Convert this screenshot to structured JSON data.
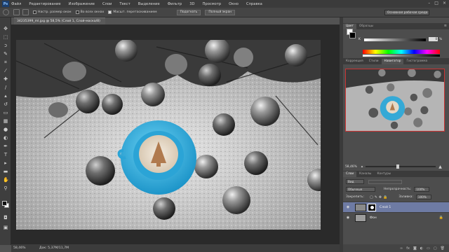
{
  "app": {
    "logo": "Ps",
    "menu": [
      "Файл",
      "Редактирование",
      "Изображение",
      "Слои",
      "Текст",
      "Выделение",
      "Фильтр",
      "3D",
      "Просмотр",
      "Окно",
      "Справка"
    ],
    "window_buttons": [
      "–",
      "□",
      "×"
    ]
  },
  "options": {
    "resize_label": "Настр. размер окон",
    "all_windows_label": "Во всех окнах",
    "scrubby_label": "Масшт. перетаскиванием",
    "fit_button": "Подогнать",
    "fullscreen_button": "Полный экран",
    "workspace": "Основная рабочая среда"
  },
  "document": {
    "tab_title": "34235399_ml.jpg @ 58,5% (Слой 1, Слой-маска/8) *",
    "close_glyph": "×",
    "zoom": "58,46%",
    "doc_size": "Док: 5,37M/11,7M"
  },
  "panels": {
    "color_tabs": [
      "Цвет",
      "Образцы"
    ],
    "color_k_label": "K",
    "color_k_value": "0",
    "color_k_unit": "%",
    "nav_tabs": [
      "Коррекция",
      "Стили",
      "Навигатор",
      "Гистограмма"
    ],
    "nav_zoom": "58,46%",
    "layers_tabs": [
      "Слои",
      "Каналы",
      "Контуры"
    ],
    "kind_label": "Вид",
    "blend_mode": "Обычные",
    "opacity_label": "Непрозрачность:",
    "opacity_value": "100%",
    "lock_label": "Закрепить:",
    "fill_label": "Заливка:",
    "fill_value": "100%",
    "layers": [
      {
        "name": "Слой 1",
        "active": true
      },
      {
        "name": "Фон",
        "active": false
      }
    ]
  },
  "colors": {
    "accent_blue": "#35a9d6",
    "active_layer": "#6e7ba4"
  }
}
